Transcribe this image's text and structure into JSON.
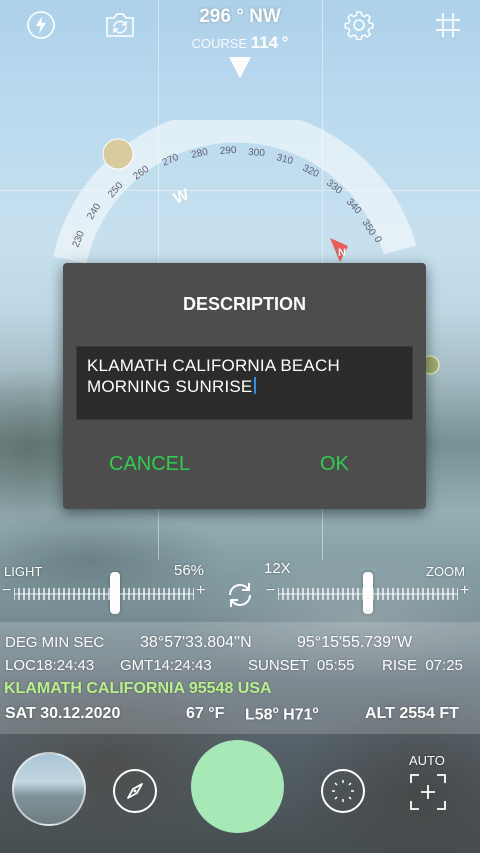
{
  "header": {
    "heading_value": "296",
    "heading_unit": "°",
    "heading_dir": "NW",
    "course_label": "COURSE",
    "course_value": "114",
    "course_unit": "°"
  },
  "compass": {
    "ticks": [
      "230",
      "240",
      "250",
      "260",
      "270",
      "280",
      "290",
      "300",
      "310",
      "320",
      "330",
      "340",
      "350",
      "0"
    ],
    "west_label": "W",
    "north_label": "N"
  },
  "dialog": {
    "title": "DESCRIPTION",
    "text_line1": "KLAMATH CALIFORNIA BEACH",
    "text_line2": "MORNING SUNRISE",
    "cancel_label": "CANCEL",
    "ok_label": "OK"
  },
  "controls": {
    "light_label": "LIGHT",
    "light_value": "56%",
    "zoom_value": "12X",
    "zoom_label": "ZOOM",
    "minus": "−",
    "plus": "+",
    "light_level": 0.56,
    "zoom_level": 0.5
  },
  "info": {
    "format_label": "DEG MIN SEC",
    "lat": "38°57'33.804''N",
    "lon": "95°15'55.739''W",
    "loc_time": "LOC18:24:43",
    "gmt_time": "GMT14:24:43",
    "sunset": "SUNSET  05:55",
    "rise": "RISE  07:25",
    "location": "KLAMATH CALIFORNIA 95548 USA",
    "date": "SAT 30.12.2020",
    "temp_value": "67",
    "temp_unit": "°F",
    "low_label": "L58",
    "high_label": "H71",
    "deg_symbol": "o",
    "altitude": "ALT 2554 FT"
  },
  "bottom": {
    "auto_label": "AUTO"
  },
  "colors": {
    "accent_green": "#2fce4f",
    "location_green": "#b8f08a",
    "shutter": "#a6e8b6",
    "dialog_bg": "#4d4d4d",
    "caret": "#2f8fe8",
    "north_marker": "#e8534f"
  }
}
